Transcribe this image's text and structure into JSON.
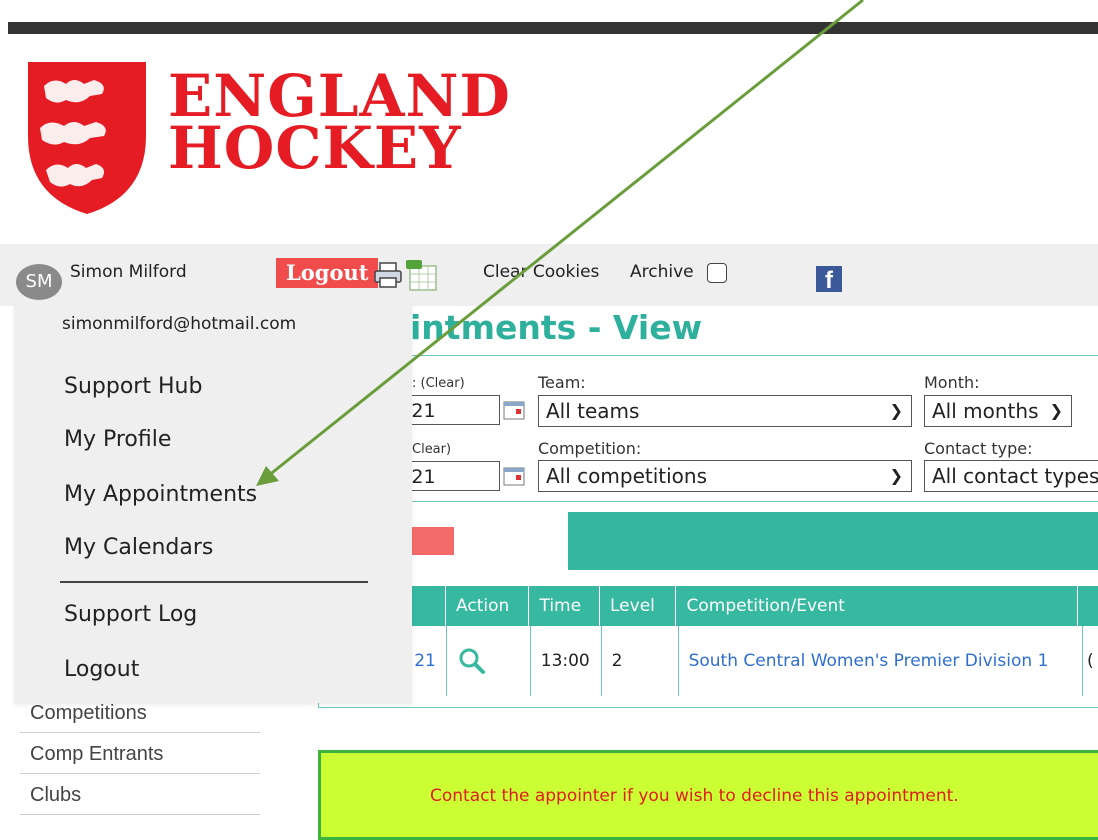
{
  "brand": {
    "line1": "ENGLAND",
    "line2": "HOCKEY",
    "color": "#e51c24"
  },
  "toolbar": {
    "avatar_initials": "SM",
    "user_name": "Simon Milford",
    "logout_label": "Logout",
    "clear_cookies_label": "Clear Cookies",
    "archive_label": "Archive",
    "facebook_glyph": "f"
  },
  "user_menu": {
    "email": "simonmilford@hotmail.com",
    "items": [
      "Support Hub",
      "My Profile",
      "My Appointments",
      "My Calendars"
    ],
    "items_after_divider": [
      "Support Log",
      "Logout"
    ]
  },
  "page": {
    "title_visible": "intments - View"
  },
  "filters": {
    "date_from_label": ": (Clear)",
    "date_from_value": ")21",
    "date_to_label": "Clear)",
    "date_to_value": ")21",
    "team_label": "Team:",
    "team_value": "All teams",
    "month_label": "Month:",
    "month_value": "All months",
    "competition_label": "Competition:",
    "competition_value": "All competitions",
    "contact_type_label": "Contact type:",
    "contact_type_value": "All contact types"
  },
  "table": {
    "headers": [
      "Action",
      "Time",
      "Level",
      "Competition/Event"
    ],
    "row": {
      "date_tail": "21",
      "time": "13:00",
      "level": "2",
      "competition": "South Central Women's Premier Division 1",
      "extra": "("
    }
  },
  "sidebar": {
    "items": [
      "Competitions",
      "Comp Entrants",
      "Clubs"
    ]
  },
  "notice": {
    "text": "Contact the appointer if you wish to decline this appointment."
  },
  "colors": {
    "accent": "#36b8a1",
    "heading": "#2eb09d",
    "logout_bg": "#f04c4c",
    "notice_bg": "#ccff33",
    "annotation_arrow": "#6a9e3c"
  }
}
